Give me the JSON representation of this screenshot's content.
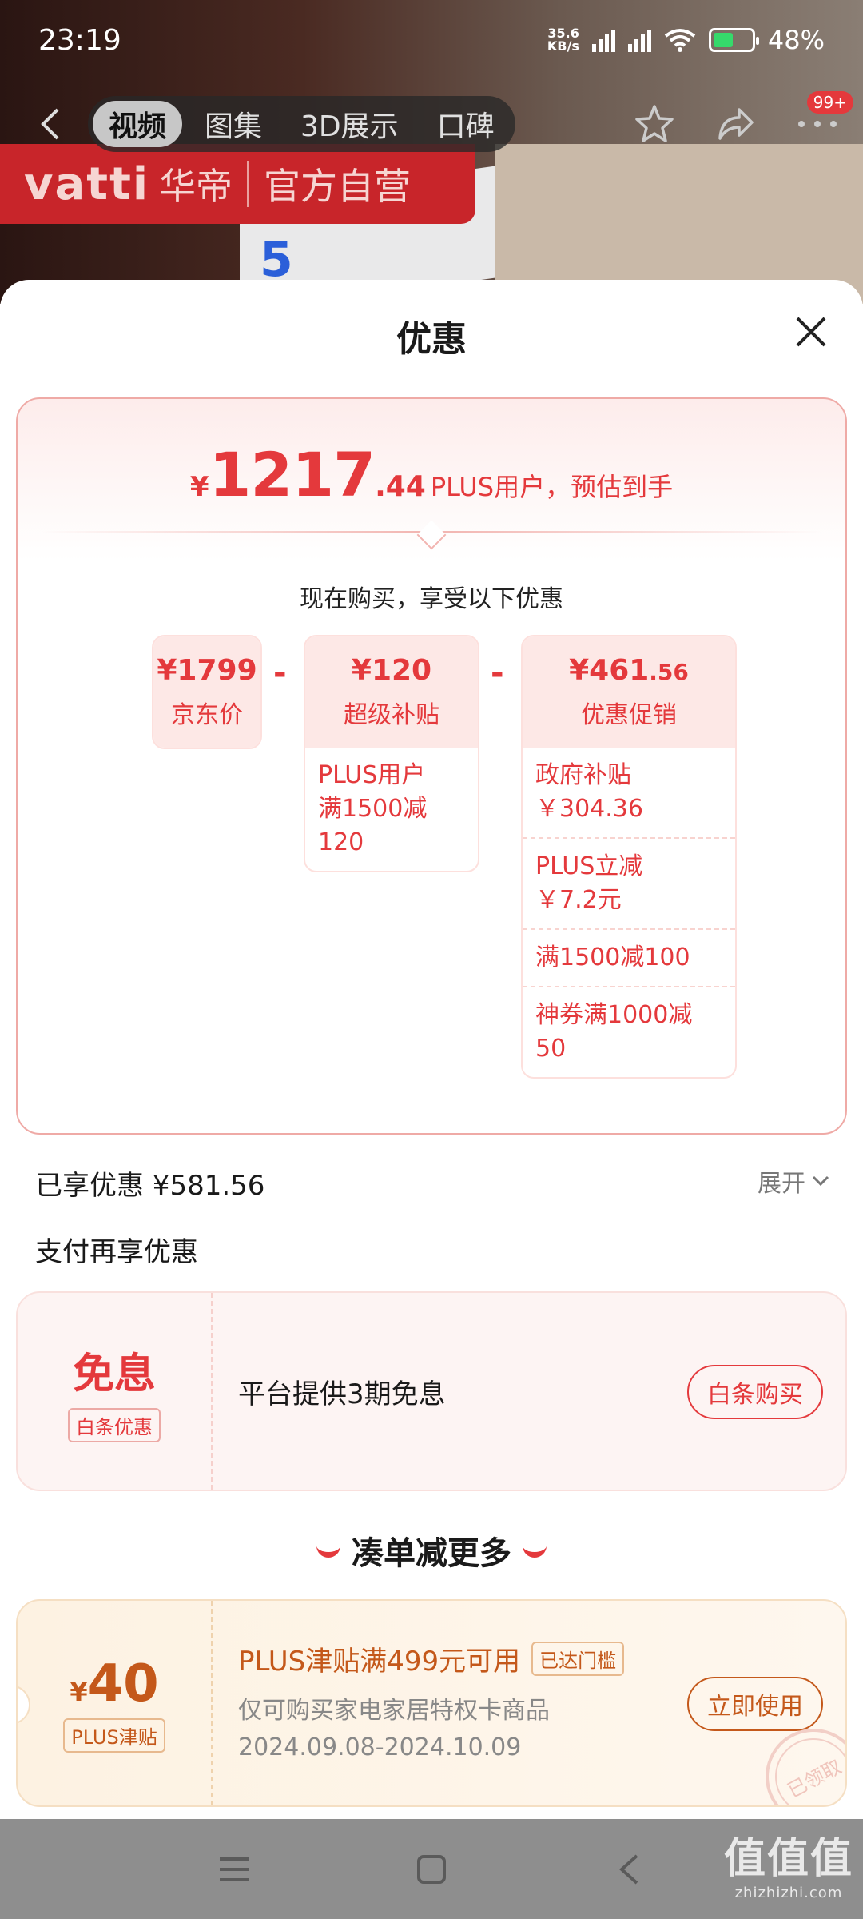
{
  "status_bar": {
    "time": "23:19",
    "net_speed_value": "35.6",
    "net_speed_unit": "KB/s",
    "battery": "48%"
  },
  "header": {
    "tabs": [
      {
        "label": "视频",
        "active": true
      },
      {
        "label": "图集"
      },
      {
        "label": "3D展示"
      },
      {
        "label": "口碑"
      }
    ],
    "badge": "99+",
    "brand_en": "vatti",
    "brand_cn": "华帝",
    "brand_tag": "官方自营"
  },
  "sheet": {
    "title": "优惠",
    "estimate": {
      "currency": "¥",
      "integer": "1217",
      "decimal": ".44",
      "desc": "PLUS用户，预估到手"
    },
    "buy_note": "现在购买，享受以下优惠",
    "breakdown": {
      "jd_price": {
        "amount": "¥1799",
        "label": "京东价"
      },
      "super_subsidy": {
        "amount": "¥120",
        "label": "超级补贴",
        "items": [
          {
            "text": "PLUS用户\n满1500减120"
          }
        ]
      },
      "promo": {
        "amount_int": "¥461",
        "amount_dec": ".56",
        "label": "优惠促销",
        "items": [
          {
            "text": "政府补贴\n￥304.36"
          },
          {
            "text": "PLUS立减\n￥7.2元"
          },
          {
            "text": "满1500减100"
          },
          {
            "text": "神券满1000减50"
          }
        ]
      }
    },
    "enjoyed": "已享优惠 ¥581.56",
    "expand_label": "展开",
    "pay_section_title": "支付再享优惠",
    "pay_card": {
      "big": "免息",
      "tag": "白条优惠",
      "desc": "平台提供3期免息",
      "button": "白条购买"
    },
    "more_title": "凑单减更多",
    "coupon": {
      "currency": "¥",
      "amount": "40",
      "tag": "PLUS津贴",
      "title": "PLUS津贴满499元可用",
      "state": "已达门槛",
      "sub": "仅可购买家电家居特权卡商品",
      "date": "2024.09.08-2024.10.09",
      "button": "立即使用",
      "stamp": "已领取"
    }
  },
  "watermark": {
    "line1": "值值值",
    "line2": "zhizhizhi.com"
  },
  "colors": {
    "accent_red": "#e4393c",
    "coupon_orange": "#c4581a"
  }
}
